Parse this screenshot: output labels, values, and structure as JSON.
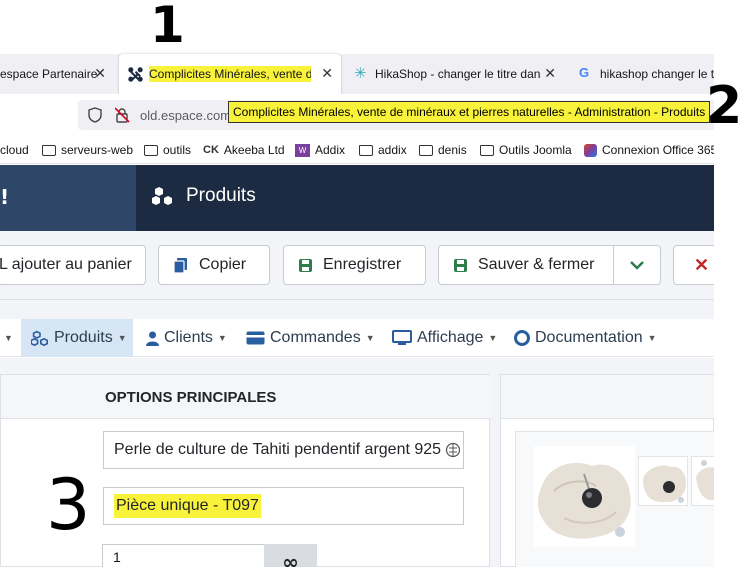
{
  "annotations": {
    "one": "1",
    "two": "2",
    "three": "3"
  },
  "browser": {
    "tabs": [
      {
        "title": "espace Partenaire | C",
        "active": false
      },
      {
        "title": "Complicites Minérales, vente d",
        "active": true
      },
      {
        "title": "HikaShop - changer le titre dans l",
        "active": false
      },
      {
        "title": "hikashop changer le t",
        "active": false
      }
    ],
    "url": "old.espace.com",
    "tooltip": "Complicites Minérales, vente de minéraux et pierres naturelles - Administration - Produits",
    "bookmarks": [
      {
        "label": "cloud",
        "icon": "folder-icon"
      },
      {
        "label": "serveurs-web",
        "icon": "folder-icon"
      },
      {
        "label": "outils",
        "icon": "folder-icon"
      },
      {
        "label": "Akeeba Ltd",
        "icon": "akeeba-icon"
      },
      {
        "label": "Addix",
        "icon": "addix-icon"
      },
      {
        "label": "addix",
        "icon": "folder-icon"
      },
      {
        "label": "denis",
        "icon": "folder-icon"
      },
      {
        "label": "Outils Joomla",
        "icon": "folder-icon"
      },
      {
        "label": "Connexion Office 365",
        "icon": "office-icon"
      }
    ]
  },
  "admin": {
    "logo": "!",
    "page_title": "Produits",
    "toolbar": {
      "add_to_cart": "L ajouter au panier",
      "copy": "Copier",
      "save": "Enregistrer",
      "save_close": "Sauver & fermer"
    },
    "menu": [
      {
        "label": "Produits",
        "icon": "cubes-icon",
        "active": true
      },
      {
        "label": "Clients",
        "icon": "user-icon",
        "active": false
      },
      {
        "label": "Commandes",
        "icon": "card-icon",
        "active": false
      },
      {
        "label": "Affichage",
        "icon": "monitor-icon",
        "active": false
      },
      {
        "label": "Documentation",
        "icon": "lifebuoy-icon",
        "active": false
      }
    ],
    "main_options_title": "OPTIONS PRINCIPALES",
    "fields": {
      "product_name": "Perle de culture de Tahiti pendentif argent 925",
      "product_code": "Pièce unique - T097",
      "quantity": "1",
      "unlimited_symbol": "∞"
    }
  },
  "colors": {
    "highlight": "#f8f33a",
    "header_bg": "#1c2b42",
    "header_logo_bg": "#2e4668",
    "menu_active_bg": "#d7e6f5",
    "save_green": "#2f7d4a",
    "danger_red": "#c52827"
  }
}
